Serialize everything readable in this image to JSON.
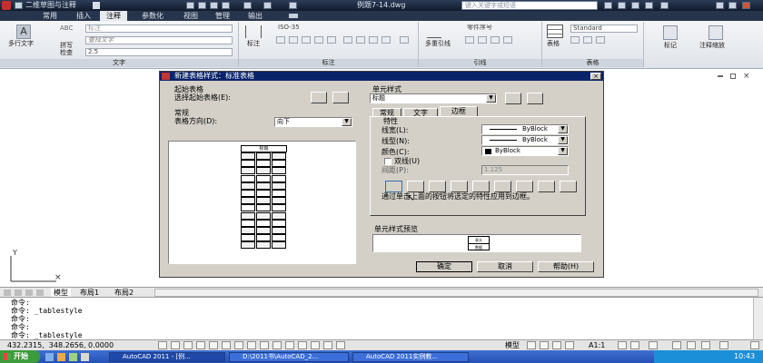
{
  "titlebar": {
    "workspace": "二维草图与注释",
    "filename": "例题7-14.dwg",
    "search_placeholder": "键入关键字或短语"
  },
  "ribbon": {
    "tabs": [
      "常用",
      "插入",
      "注释",
      "参数化",
      "视图",
      "管理",
      "输出"
    ],
    "active_tab": "注释",
    "text_group": {
      "title": "文字",
      "mtext_label": "多行文字",
      "spell_check": "拼写检查",
      "abc": "ABC",
      "style_placeholder": "标注",
      "find_placeholder": "查找文字",
      "height": "2.5"
    },
    "dim_group": {
      "title": "标注",
      "dim_label": "标注",
      "style": "ISO-35"
    },
    "leader_group": {
      "title": "引线",
      "multileader": "多重引线",
      "style": "零件序号"
    },
    "table_group": {
      "title": "表格",
      "table_label": "表格",
      "style": "Standard"
    },
    "mark_label": "标记",
    "scale_label": "注释缩放"
  },
  "dialog": {
    "title": "新建表格样式：标准表格",
    "start_table_label": "起始表格",
    "select_start_table": "选择起始表格(E):",
    "general_label": "常规",
    "direction_label": "表格方向(D):",
    "direction_value": "向下",
    "cell_style_label": "单元样式",
    "cell_style_value": "标题",
    "tabs": [
      "常规",
      "文字",
      "边框"
    ],
    "active_tab": "边框",
    "props_label": "特性",
    "lineweight_label": "线宽(L):",
    "lineweight_value": "ByBlock",
    "linetype_label": "线型(N):",
    "linetype_value": "ByBlock",
    "color_label": "颜色(C):",
    "color_value": "ByBlock",
    "double_line_label": "双线(U)",
    "spacing_label": "间距(P):",
    "spacing_value": "1.125",
    "hint": "通过单击上面的按钮将选定的特性应用到边框。",
    "preview_label": "单元样式预览",
    "ok": "确定",
    "cancel": "取消",
    "help": "帮助(H)",
    "preview_table_title": "标题",
    "preview_cell_labels": [
      "表头",
      "数据"
    ]
  },
  "layout_tabs": [
    "模型",
    "布局1",
    "布局2"
  ],
  "command_lines": [
    "命令:",
    "命令: _tablestyle",
    "命令:",
    "命令:",
    "命令: _tablestyle"
  ],
  "status": {
    "coords": "432.2315,  348.2656, 0.0000",
    "model": "模型",
    "scale": "A1:1"
  },
  "taskbar": {
    "start": "开始",
    "tasks": [
      "AutoCAD 2011 - [例...",
      "D:\\2011书\\AutoCAD_2...",
      "AutoCAD 2011实例教..."
    ],
    "clock": "10:43"
  },
  "colors": {
    "titlebar": "#1a2436",
    "dialog_title": "#0a246a",
    "taskbar": "#2f5fc4"
  }
}
